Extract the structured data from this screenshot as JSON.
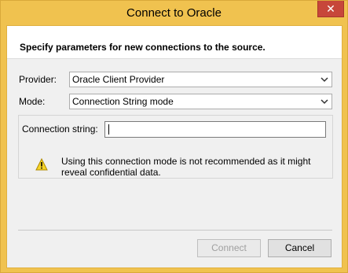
{
  "window": {
    "title": "Connect to Oracle",
    "close_glyph": "✕"
  },
  "header": {
    "instruction": "Specify parameters for new connections to the source."
  },
  "form": {
    "provider_label": "Provider:",
    "provider_value": "Oracle Client Provider",
    "mode_label": "Mode:",
    "mode_value": "Connection String mode",
    "connection_string_label": "Connection string:",
    "connection_string_value": ""
  },
  "warning": {
    "icon": "warning-icon",
    "text": "Using this connection mode is not recommended as it might reveal confidential data."
  },
  "buttons": {
    "connect_label": "Connect",
    "cancel_label": "Cancel"
  },
  "colors": {
    "titlebar": "#f0c24f",
    "close_button": "#c7463a"
  }
}
